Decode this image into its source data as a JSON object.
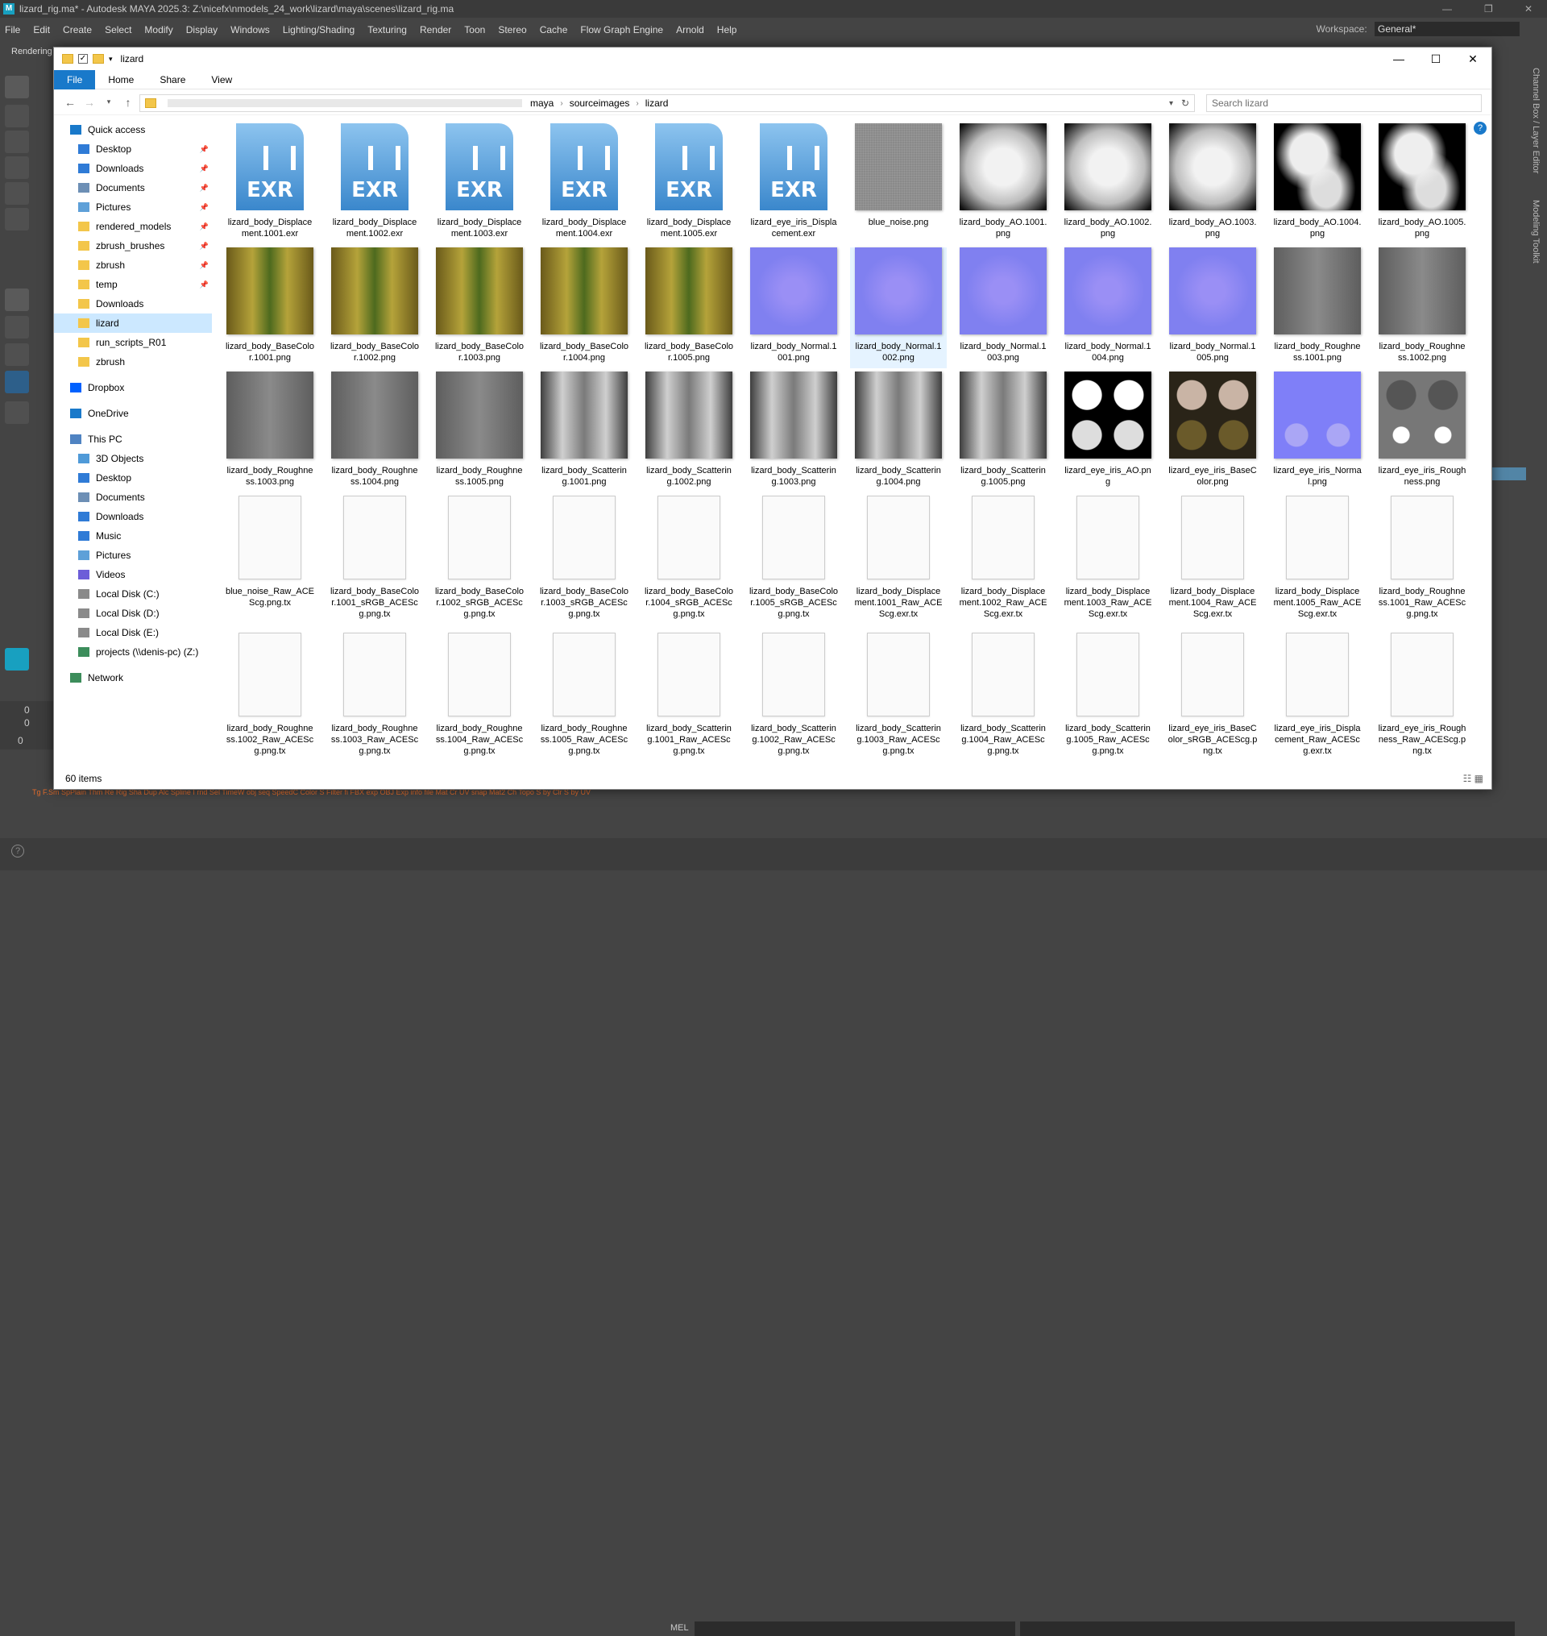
{
  "maya": {
    "title": "lizard_rig.ma* - Autodesk MAYA 2025.3: Z:\\nicefx\\nmodels_24_work\\lizard\\maya\\scenes\\lizard_rig.ma",
    "logo": "M",
    "menus": [
      "File",
      "Edit",
      "Create",
      "Select",
      "Modify",
      "Display",
      "Windows",
      "Lighting/Shading",
      "Texturing",
      "Render",
      "Toon",
      "Stereo",
      "Cache",
      "Flow Graph Engine",
      "Arnold",
      "Help"
    ],
    "workspace_label": "Workspace:",
    "workspace_value": "General*",
    "shelf_tab": "Rendering",
    "right_panel_1": "Channel Box / Layer Editor",
    "right_panel_2": "Modeling Toolkit",
    "cmd_lang": "MEL",
    "frame_a": "0",
    "frame_b": "0",
    "frame_c": "0",
    "shelf_bottom": "Tg F.Sm SpPlain Thm Re Rig Sha Dup Alc Spline I   rnd Sel TimeW obj seq  SpeedC Color S Filter fi FBX exp OBJ Exp info file Mat Cr UV snap  Mat2   Ch Topo S by Clr S by UV"
  },
  "explorer": {
    "title": "lizard",
    "controls": [
      "—",
      "☐",
      "✕"
    ],
    "ribbon": [
      "File",
      "Home",
      "Share",
      "View"
    ],
    "breadcrumb": [
      "maya",
      "sourceimages",
      "lizard"
    ],
    "search_placeholder": "Search lizard",
    "status": "60 items",
    "nav": [
      {
        "label": "Quick access",
        "type": "star",
        "pinned": false,
        "indent": 0
      },
      {
        "label": "Desktop",
        "type": "desk",
        "pinned": true,
        "indent": 1
      },
      {
        "label": "Downloads",
        "type": "down",
        "pinned": true,
        "indent": 1
      },
      {
        "label": "Documents",
        "type": "docs",
        "pinned": true,
        "indent": 1
      },
      {
        "label": "Pictures",
        "type": "pics",
        "pinned": true,
        "indent": 1
      },
      {
        "label": "rendered_models",
        "type": "folder",
        "pinned": true,
        "indent": 1
      },
      {
        "label": "zbrush_brushes",
        "type": "folder",
        "pinned": true,
        "indent": 1
      },
      {
        "label": "zbrush",
        "type": "folder",
        "pinned": true,
        "indent": 1
      },
      {
        "label": "temp",
        "type": "folder",
        "pinned": true,
        "indent": 1
      },
      {
        "label": "Downloads",
        "type": "folder",
        "pinned": false,
        "indent": 1
      },
      {
        "label": "lizard",
        "type": "folder",
        "pinned": false,
        "indent": 1,
        "selected": true
      },
      {
        "label": "run_scripts_R01",
        "type": "folder",
        "pinned": false,
        "indent": 1
      },
      {
        "label": "zbrush",
        "type": "folder",
        "pinned": false,
        "indent": 1
      },
      {
        "label": "Dropbox",
        "type": "dropbox",
        "pinned": false,
        "indent": 0,
        "gap": true
      },
      {
        "label": "OneDrive",
        "type": "cloud",
        "pinned": false,
        "indent": 0,
        "gap": true
      },
      {
        "label": "This PC",
        "type": "pc",
        "pinned": false,
        "indent": 0,
        "gap": true
      },
      {
        "label": "3D Objects",
        "type": "obj",
        "pinned": false,
        "indent": 1
      },
      {
        "label": "Desktop",
        "type": "desk",
        "pinned": false,
        "indent": 1
      },
      {
        "label": "Documents",
        "type": "docs",
        "pinned": false,
        "indent": 1
      },
      {
        "label": "Downloads",
        "type": "down",
        "pinned": false,
        "indent": 1
      },
      {
        "label": "Music",
        "type": "music",
        "pinned": false,
        "indent": 1
      },
      {
        "label": "Pictures",
        "type": "pics",
        "pinned": false,
        "indent": 1
      },
      {
        "label": "Videos",
        "type": "vid",
        "pinned": false,
        "indent": 1
      },
      {
        "label": "Local Disk (C:)",
        "type": "disk",
        "pinned": false,
        "indent": 1
      },
      {
        "label": "Local Disk (D:)",
        "type": "disk",
        "pinned": false,
        "indent": 1
      },
      {
        "label": "Local Disk (E:)",
        "type": "disk",
        "pinned": false,
        "indent": 1
      },
      {
        "label": "projects (\\\\denis-pc) (Z:)",
        "type": "net",
        "pinned": false,
        "indent": 1
      },
      {
        "label": "Network",
        "type": "net",
        "pinned": false,
        "indent": 0,
        "gap": true
      }
    ],
    "files": [
      {
        "name": "lizard_body_Displacement.1001.exr",
        "kind": "exr"
      },
      {
        "name": "lizard_body_Displacement.1002.exr",
        "kind": "exr"
      },
      {
        "name": "lizard_body_Displacement.1003.exr",
        "kind": "exr"
      },
      {
        "name": "lizard_body_Displacement.1004.exr",
        "kind": "exr"
      },
      {
        "name": "lizard_body_Displacement.1005.exr",
        "kind": "exr"
      },
      {
        "name": "lizard_eye_iris_Displacement.exr",
        "kind": "exr"
      },
      {
        "name": "blue_noise.png",
        "kind": "noise"
      },
      {
        "name": "lizard_body_AO.1001.png",
        "kind": "ao"
      },
      {
        "name": "lizard_body_AO.1002.png",
        "kind": "ao"
      },
      {
        "name": "lizard_body_AO.1003.png",
        "kind": "ao"
      },
      {
        "name": "lizard_body_AO.1004.png",
        "kind": "ao2"
      },
      {
        "name": "lizard_body_AO.1005.png",
        "kind": "ao2"
      },
      {
        "name": "lizard_body_BaseColor.1001.png",
        "kind": "color"
      },
      {
        "name": "lizard_body_BaseColor.1002.png",
        "kind": "color"
      },
      {
        "name": "lizard_body_BaseColor.1003.png",
        "kind": "color"
      },
      {
        "name": "lizard_body_BaseColor.1004.png",
        "kind": "color"
      },
      {
        "name": "lizard_body_BaseColor.1005.png",
        "kind": "color"
      },
      {
        "name": "lizard_body_Normal.1001.png",
        "kind": "normal"
      },
      {
        "name": "lizard_body_Normal.1002.png",
        "kind": "normal",
        "selected": true
      },
      {
        "name": "lizard_body_Normal.1003.png",
        "kind": "normal"
      },
      {
        "name": "lizard_body_Normal.1004.png",
        "kind": "normal"
      },
      {
        "name": "lizard_body_Normal.1005.png",
        "kind": "normal"
      },
      {
        "name": "lizard_body_Roughness.1001.png",
        "kind": "rough"
      },
      {
        "name": "lizard_body_Roughness.1002.png",
        "kind": "rough"
      },
      {
        "name": "lizard_body_Roughness.1003.png",
        "kind": "rough"
      },
      {
        "name": "lizard_body_Roughness.1004.png",
        "kind": "rough"
      },
      {
        "name": "lizard_body_Roughness.1005.png",
        "kind": "rough"
      },
      {
        "name": "lizard_body_Scattering.1001.png",
        "kind": "scatter"
      },
      {
        "name": "lizard_body_Scattering.1002.png",
        "kind": "scatter"
      },
      {
        "name": "lizard_body_Scattering.1003.png",
        "kind": "scatter"
      },
      {
        "name": "lizard_body_Scattering.1004.png",
        "kind": "scatter"
      },
      {
        "name": "lizard_body_Scattering.1005.png",
        "kind": "scatter"
      },
      {
        "name": "lizard_eye_iris_AO.png",
        "kind": "eyeao"
      },
      {
        "name": "lizard_eye_iris_BaseColor.png",
        "kind": "eyecol"
      },
      {
        "name": "lizard_eye_iris_Normal.png",
        "kind": "eyenorm"
      },
      {
        "name": "lizard_eye_iris_Roughness.png",
        "kind": "eyerough"
      },
      {
        "name": "blue_noise_Raw_ACEScg.png.tx",
        "kind": "doc"
      },
      {
        "name": "lizard_body_BaseColor.1001_sRGB_ACEScg.png.tx",
        "kind": "doc"
      },
      {
        "name": "lizard_body_BaseColor.1002_sRGB_ACEScg.png.tx",
        "kind": "doc"
      },
      {
        "name": "lizard_body_BaseColor.1003_sRGB_ACEScg.png.tx",
        "kind": "doc"
      },
      {
        "name": "lizard_body_BaseColor.1004_sRGB_ACEScg.png.tx",
        "kind": "doc"
      },
      {
        "name": "lizard_body_BaseColor.1005_sRGB_ACEScg.png.tx",
        "kind": "doc"
      },
      {
        "name": "lizard_body_Displacement.1001_Raw_ACEScg.exr.tx",
        "kind": "doc"
      },
      {
        "name": "lizard_body_Displacement.1002_Raw_ACEScg.exr.tx",
        "kind": "doc"
      },
      {
        "name": "lizard_body_Displacement.1003_Raw_ACEScg.exr.tx",
        "kind": "doc"
      },
      {
        "name": "lizard_body_Displacement.1004_Raw_ACEScg.exr.tx",
        "kind": "doc"
      },
      {
        "name": "lizard_body_Displacement.1005_Raw_ACEScg.exr.tx",
        "kind": "doc"
      },
      {
        "name": "lizard_body_Roughness.1001_Raw_ACEScg.png.tx",
        "kind": "doc"
      },
      {
        "name": "lizard_body_Roughness.1002_Raw_ACEScg.png.tx",
        "kind": "doc"
      },
      {
        "name": "lizard_body_Roughness.1003_Raw_ACEScg.png.tx",
        "kind": "doc"
      },
      {
        "name": "lizard_body_Roughness.1004_Raw_ACEScg.png.tx",
        "kind": "doc"
      },
      {
        "name": "lizard_body_Roughness.1005_Raw_ACEScg.png.tx",
        "kind": "doc"
      },
      {
        "name": "lizard_body_Scattering.1001_Raw_ACEScg.png.tx",
        "kind": "doc"
      },
      {
        "name": "lizard_body_Scattering.1002_Raw_ACEScg.png.tx",
        "kind": "doc"
      },
      {
        "name": "lizard_body_Scattering.1003_Raw_ACEScg.png.tx",
        "kind": "doc"
      },
      {
        "name": "lizard_body_Scattering.1004_Raw_ACEScg.png.tx",
        "kind": "doc"
      },
      {
        "name": "lizard_body_Scattering.1005_Raw_ACEScg.png.tx",
        "kind": "doc"
      },
      {
        "name": "lizard_eye_iris_BaseColor_sRGB_ACEScg.png.tx",
        "kind": "doc"
      },
      {
        "name": "lizard_eye_iris_Displacement_Raw_ACEScg.exr.tx",
        "kind": "doc"
      },
      {
        "name": "lizard_eye_iris_Roughness_Raw_ACEScg.png.tx",
        "kind": "doc"
      }
    ]
  },
  "colors": {
    "accent": "#1979ca",
    "selection": "#cce8ff",
    "normal_map": "#7f7ff8",
    "maya_bg": "#444444"
  }
}
